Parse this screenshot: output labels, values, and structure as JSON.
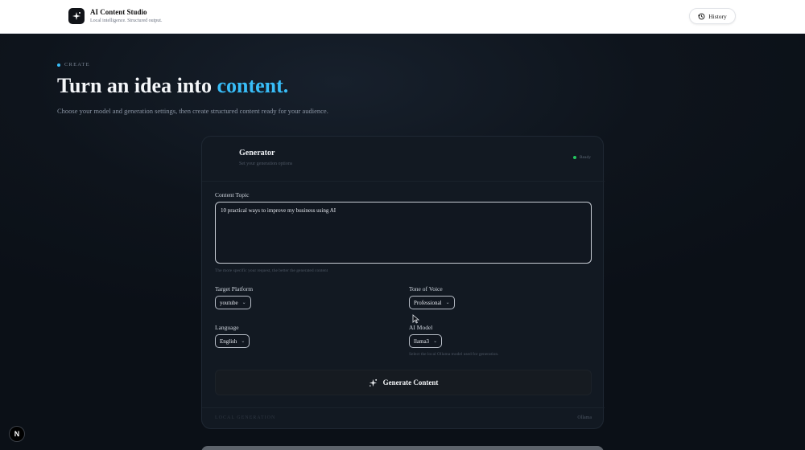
{
  "header": {
    "brand_title": "AI Content Studio",
    "brand_subtitle": "Local intelligence. Structured output.",
    "history_label": "History"
  },
  "hero": {
    "eyebrow": "CREATE",
    "headline_main": "Turn an idea into ",
    "headline_accent": "content.",
    "lead": "Choose your model and generation settings, then create structured content ready for your audience."
  },
  "generator": {
    "title": "Generator",
    "subtitle": "Set your generation options",
    "status": "Ready",
    "topic_label": "Content Topic",
    "topic_value": "10 practical ways to improve my business using AI",
    "topic_hint": "The more specific your request, the better the generated content",
    "platform_label": "Target Platform",
    "platform_value": "youtube",
    "tone_label": "Tone of Voice",
    "tone_value": "Professional",
    "language_label": "Language",
    "language_value": "English",
    "model_label": "AI Model",
    "model_value": "llama3",
    "model_hint": "Select the local Ollama model used for generation.",
    "generate_label": "Generate Content",
    "footer_left": "LOCAL GENERATION",
    "footer_right": "Ollama"
  },
  "badge": {
    "letter": "N"
  },
  "colors": {
    "accent": "#38bdf8",
    "status_ok": "#22c55e",
    "background": "#0d1117"
  }
}
